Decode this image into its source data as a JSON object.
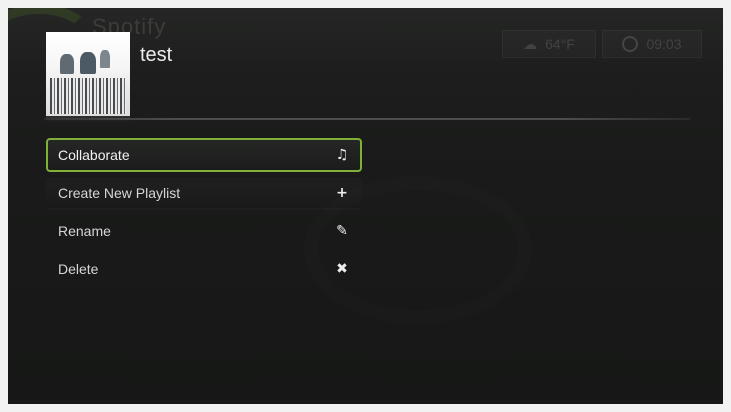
{
  "header": {
    "brand_text": "Spotify",
    "playlist_title": "test",
    "weather_icon": "weather-icon",
    "temperature": "64°F",
    "clock_icon": "clock-icon",
    "time": "09:03"
  },
  "menu": {
    "items": [
      {
        "label": "Collaborate",
        "icon": "music-note-icon",
        "glyph": "♫",
        "selected": true
      },
      {
        "label": "Create New Playlist",
        "icon": "plus-icon",
        "glyph": "+",
        "selected": false
      },
      {
        "label": "Rename",
        "icon": "pencil-icon",
        "glyph": "✎",
        "selected": false
      },
      {
        "label": "Delete",
        "icon": "close-icon",
        "glyph": "✖",
        "selected": false
      }
    ]
  },
  "colors": {
    "accent": "#7fb13a",
    "background": "#1b1c1b",
    "text": "#d6d6d6"
  }
}
